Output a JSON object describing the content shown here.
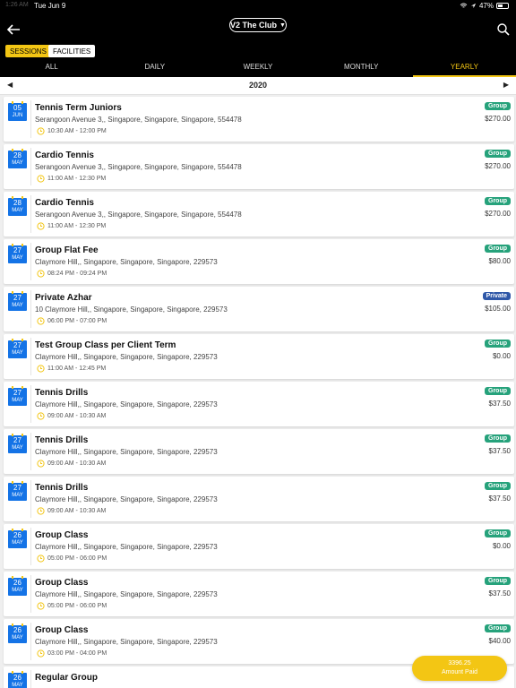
{
  "status_bar": {
    "time": "1:26 AM",
    "date": "Tue Jun 9",
    "battery": "47%"
  },
  "header": {
    "club_name": "V2 The Club"
  },
  "colors": {
    "accent": "#f3c614",
    "calendar": "#1473e6",
    "group_badge": "#26a27b",
    "private_badge": "#2f58a8"
  },
  "filters": {
    "sessions_label": "SESSIONS",
    "facilities_label": "FACILITIES"
  },
  "tabs": [
    {
      "label": "ALL",
      "active": false
    },
    {
      "label": "DAILY",
      "active": false
    },
    {
      "label": "WEEKLY",
      "active": false
    },
    {
      "label": "MONTHLY",
      "active": false
    },
    {
      "label": "YEARLY",
      "active": true
    }
  ],
  "year": "2020",
  "sessions": [
    {
      "day": "05",
      "month": "JUN",
      "title": "Tennis Term Juniors",
      "address": "Serangoon Avenue 3,, Singapore, Singapore, Singapore, 554478",
      "time": "10:30 AM - 12:00 PM",
      "type": "Group",
      "price": "$270.00"
    },
    {
      "day": "28",
      "month": "MAY",
      "title": "Cardio Tennis",
      "address": "Serangoon Avenue 3,, Singapore, Singapore, Singapore, 554478",
      "time": "11:00 AM - 12:30 PM",
      "type": "Group",
      "price": "$270.00"
    },
    {
      "day": "28",
      "month": "MAY",
      "title": "Cardio Tennis",
      "address": "Serangoon Avenue 3,, Singapore, Singapore, Singapore, 554478",
      "time": "11:00 AM - 12:30 PM",
      "type": "Group",
      "price": "$270.00"
    },
    {
      "day": "27",
      "month": "MAY",
      "title": "Group Flat Fee",
      "address": "Claymore Hill,, Singapore, Singapore, Singapore, 229573",
      "time": "08:24 PM - 09:24 PM",
      "type": "Group",
      "price": "$80.00"
    },
    {
      "day": "27",
      "month": "MAY",
      "title": "Private Azhar",
      "address": "10 Claymore Hill,, Singapore, Singapore, Singapore, 229573",
      "time": "06:00 PM - 07:00 PM",
      "type": "Private",
      "price": "$105.00"
    },
    {
      "day": "27",
      "month": "MAY",
      "title": "Test Group Class per Client Term",
      "address": "Claymore Hill,, Singapore, Singapore, Singapore, 229573",
      "time": "11:00 AM - 12:45 PM",
      "type": "Group",
      "price": "$0.00"
    },
    {
      "day": "27",
      "month": "MAY",
      "title": "Tennis Drills",
      "address": "Claymore Hill,, Singapore, Singapore, Singapore, 229573",
      "time": "09:00 AM - 10:30 AM",
      "type": "Group",
      "price": "$37.50"
    },
    {
      "day": "27",
      "month": "MAY",
      "title": "Tennis Drills",
      "address": "Claymore Hill,, Singapore, Singapore, Singapore, 229573",
      "time": "09:00 AM - 10:30 AM",
      "type": "Group",
      "price": "$37.50"
    },
    {
      "day": "27",
      "month": "MAY",
      "title": "Tennis Drills",
      "address": "Claymore Hill,, Singapore, Singapore, Singapore, 229573",
      "time": "09:00 AM - 10:30 AM",
      "type": "Group",
      "price": "$37.50"
    },
    {
      "day": "26",
      "month": "MAY",
      "title": "Group Class",
      "address": "Claymore Hill,, Singapore, Singapore, Singapore, 229573",
      "time": "05:00 PM - 06:00 PM",
      "type": "Group",
      "price": "$0.00"
    },
    {
      "day": "26",
      "month": "MAY",
      "title": "Group Class",
      "address": "Claymore Hill,, Singapore, Singapore, Singapore, 229573",
      "time": "05:00 PM - 06:00 PM",
      "type": "Group",
      "price": "$37.50"
    },
    {
      "day": "26",
      "month": "MAY",
      "title": "Group Class",
      "address": "Claymore Hill,, Singapore, Singapore, Singapore, 229573",
      "time": "03:00 PM - 04:00 PM",
      "type": "Group",
      "price": "$40.00"
    },
    {
      "day": "26",
      "month": "MAY",
      "title": "Regular Group",
      "address": "",
      "time": "",
      "type": "",
      "price": ""
    }
  ],
  "amount_paid": {
    "value": "3396.25",
    "label": "Amount Paid"
  }
}
